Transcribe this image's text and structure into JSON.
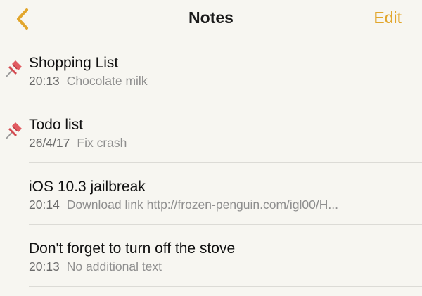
{
  "navbar": {
    "back_icon": "chevron-left-icon",
    "title": "Notes",
    "edit_label": "Edit",
    "accent_color": "#e2a62c"
  },
  "notes": [
    {
      "title": "Shopping List",
      "time": "20:13",
      "preview": "Chocolate milk",
      "pinned": true
    },
    {
      "title": "Todo list",
      "time": "26/4/17",
      "preview": "Fix crash",
      "pinned": true
    },
    {
      "title": "iOS 10.3 jailbreak",
      "time": "20:14",
      "preview": "Download link http://frozen-penguin.com/igl00/H...",
      "pinned": false
    },
    {
      "title": "Don't forget to turn off the stove",
      "time": "20:13",
      "preview": "No additional text",
      "pinned": false
    }
  ]
}
